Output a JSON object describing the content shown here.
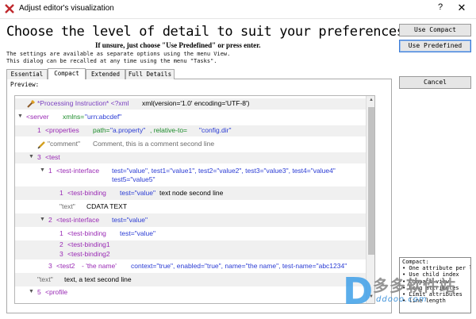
{
  "window": {
    "title": "Adjust editor's visualization",
    "help": "?",
    "close": "✕"
  },
  "header": {
    "headline": "Choose the level of detail to suit your preferences",
    "subline": "If unsure, just choose \"Use Predefined\" or press enter.",
    "info1": "The settings are available as separate options using the menu View.",
    "info2": "This dialog can be recalled at any time using the menu \"Tasks\"."
  },
  "buttons": {
    "use_compact": "Use Compact",
    "use_predefined": "Use Predefined",
    "cancel": "Cancel"
  },
  "tabs": [
    {
      "label": "Essential"
    },
    {
      "label": "Compact"
    },
    {
      "label": "Extended"
    },
    {
      "label": "Full Details"
    }
  ],
  "active_tab": "Compact",
  "preview_label": "Preview:",
  "tree": {
    "r1": {
      "pi": "*Processing Instruction* <?xml",
      "rest": "xml(version='1.0' encoding='UTF-8')"
    },
    "r2": {
      "tag": "<server",
      "attr": "xmlns=",
      "val": "\"urn:abcdef\""
    },
    "r3": {
      "num": "1",
      "tag": "<properties",
      "a1": "path=",
      "v1": "\"a.property\"",
      "a2": ", relative-to=",
      "v2": "\"config.dir\""
    },
    "r4": {
      "label": "\"comment\"",
      "text": "Comment, this is a comment second line"
    },
    "r5": {
      "num": "3",
      "tag": "<test"
    },
    "r6": {
      "num": "1",
      "tag": "<test-interface",
      "l1": "test=\"value\", test1=\"value1\", test2=\"value2\", test3=\"value3\", test4=\"value4\"",
      "l2": "test5=\"value5\""
    },
    "r7": {
      "num": "1",
      "tag": "<test-binding",
      "a": "test=\"value\"",
      "text": "text node second line"
    },
    "r8": {
      "label": "\"text\"",
      "text": "CDATA TEXT"
    },
    "r9": {
      "num": "2",
      "tag": "<test-interface",
      "a": "test=\"value\""
    },
    "r10": {
      "num": "1",
      "tag": "<test-binding",
      "a": "test=\"value\""
    },
    "r11": {
      "num": "2",
      "tag": "<test-binding1"
    },
    "r12": {
      "num": "3",
      "tag": "<test-binding2"
    },
    "r13": {
      "num": "3",
      "tag": "<test2",
      "name": "- 'the name'",
      "attrs": "context=\"true\", enabled=\"true\", name=\"the name\", test-name=\"abc1234\""
    },
    "r14": {
      "label": "\"text\"",
      "text": "text, a text second line"
    },
    "r15": {
      "num": "5",
      "tag": "<profile"
    }
  },
  "legend": {
    "title": "Compact:",
    "lines": [
      "• One attribute per l",
      "• Use child index",
      "• Compact view",
      "• Long attributes",
      "• Limit attributes",
      "• line length"
    ]
  },
  "watermark": {
    "cn": "多多软件站",
    "url": "ddooo.com"
  },
  "colors": {
    "tag": "#9a2bb5",
    "attr": "#1d8c2b",
    "value": "#2a3bd4",
    "default_button_border": "#3b7bd5"
  }
}
